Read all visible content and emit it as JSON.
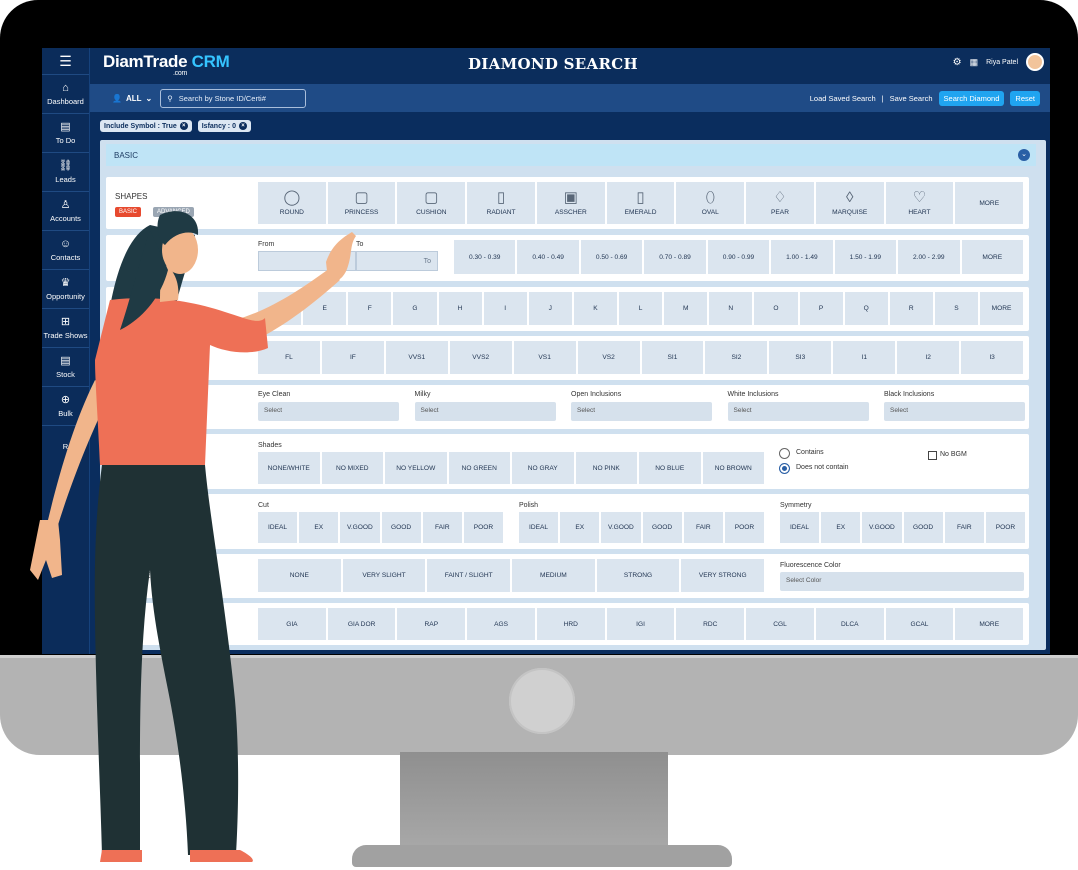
{
  "app": {
    "logo": "DiamTrade",
    "logo_crm": "CRM",
    "logo_sub": ".com",
    "page_title": "DIAMOND SEARCH",
    "user": "Riya Patel"
  },
  "sidebar": {
    "items": [
      {
        "label": "Dashboard",
        "icon": "home-icon"
      },
      {
        "label": "To Do",
        "icon": "clipboard-icon"
      },
      {
        "label": "Leads",
        "icon": "handshake-icon"
      },
      {
        "label": "Accounts",
        "icon": "user-lock-icon"
      },
      {
        "label": "Contacts",
        "icon": "contacts-icon"
      },
      {
        "label": "Opportunity",
        "icon": "crown-icon"
      },
      {
        "label": "Trade Shows",
        "icon": "trade-icon"
      },
      {
        "label": "Stock",
        "icon": "stock-icon"
      },
      {
        "label": "Bulk",
        "icon": "bulk-icon"
      },
      {
        "label": "R",
        "icon": ""
      }
    ]
  },
  "search": {
    "scope": "ALL",
    "placeholder": "Search by Stone ID/Certi#",
    "load_saved": "Load Saved Search",
    "sep": "|",
    "save": "Save Search",
    "search_btn": "Search Diamond",
    "reset_btn": "Reset"
  },
  "chips": [
    "Include Symbol : True",
    "Isfancy : 0"
  ],
  "section_title": "BASIC",
  "shapes": {
    "label": "SHAPES",
    "tab_basic": "BASIC",
    "tab_advanced": "ADVANCED",
    "items": [
      {
        "n": "ROUND",
        "g": "◯"
      },
      {
        "n": "PRINCESS",
        "g": "▢"
      },
      {
        "n": "CUSHION",
        "g": "▢"
      },
      {
        "n": "RADIANT",
        "g": "▯"
      },
      {
        "n": "ASSCHER",
        "g": "▣"
      },
      {
        "n": "EMERALD",
        "g": "▯"
      },
      {
        "n": "OVAL",
        "g": "⬯"
      },
      {
        "n": "PEAR",
        "g": "♢"
      },
      {
        "n": "MARQUISE",
        "g": "◊"
      },
      {
        "n": "HEART",
        "g": "♡"
      }
    ],
    "more": "MORE"
  },
  "carat": {
    "from_label": "From",
    "to_label": "To",
    "from_ph": "From",
    "to_ph": "To",
    "ranges": [
      "0.30 - 0.39",
      "0.40 - 0.49",
      "0.50 - 0.69",
      "0.70 - 0.89",
      "0.90 - 0.99",
      "1.00 - 1.49",
      "1.50 - 1.99",
      "2.00 - 2.99"
    ],
    "more": "MORE"
  },
  "colors": {
    "items": [
      "D",
      "E",
      "F",
      "G",
      "H",
      "I",
      "J",
      "K",
      "L",
      "M",
      "N",
      "O",
      "P",
      "Q",
      "R",
      "S"
    ],
    "more": "MORE"
  },
  "clarity": [
    "FL",
    "IF",
    "VVS1",
    "VVS2",
    "VS1",
    "VS2",
    "SI1",
    "SI2",
    "SI3",
    "I1",
    "I2",
    "I3"
  ],
  "inclusions": [
    {
      "label": "Eye Clean",
      "value": "Select"
    },
    {
      "label": "Milky",
      "value": "Select"
    },
    {
      "label": "Open Inclusions",
      "value": "Select"
    },
    {
      "label": "White Inclusions",
      "value": "Select"
    },
    {
      "label": "Black Inclusions",
      "value": "Select"
    }
  ],
  "shades": {
    "label": "Shades",
    "items": [
      "NONE/WHITE",
      "NO MIXED",
      "NO YELLOW",
      "NO GREEN",
      "NO GRAY",
      "NO PINK",
      "NO BLUE",
      "NO BROWN"
    ],
    "contains": "Contains",
    "not_contains": "Does not contain",
    "no_bgm": "No BGM"
  },
  "finish": {
    "cut_label": "Cut",
    "polish_label": "Polish",
    "symmetry_label": "Symmetry",
    "grades": [
      "IDEAL",
      "EX",
      "V.GOOD",
      "GOOD",
      "FAIR",
      "POOR"
    ]
  },
  "fluorescence": {
    "label": "SCE",
    "items": [
      "NONE",
      "VERY SLIGHT",
      "FAINT / SLIGHT",
      "MEDIUM",
      "STRONG",
      "VERY STRONG"
    ],
    "color_label": "Fluorescence Color",
    "color_value": "Select Color"
  },
  "labs": {
    "items": [
      "GIA",
      "GIA DOR",
      "RAP",
      "AGS",
      "HRD",
      "IGI",
      "RDC",
      "CGL",
      "DLCA",
      "GCAL"
    ],
    "more": "MORE"
  },
  "colors_theme": {
    "nav": "#0b2c5a",
    "accent": "#20a4f0",
    "basic_tag": "#e74a2f",
    "advanced_tag": "#9aa6b3",
    "panel": "#cfe0ef"
  }
}
